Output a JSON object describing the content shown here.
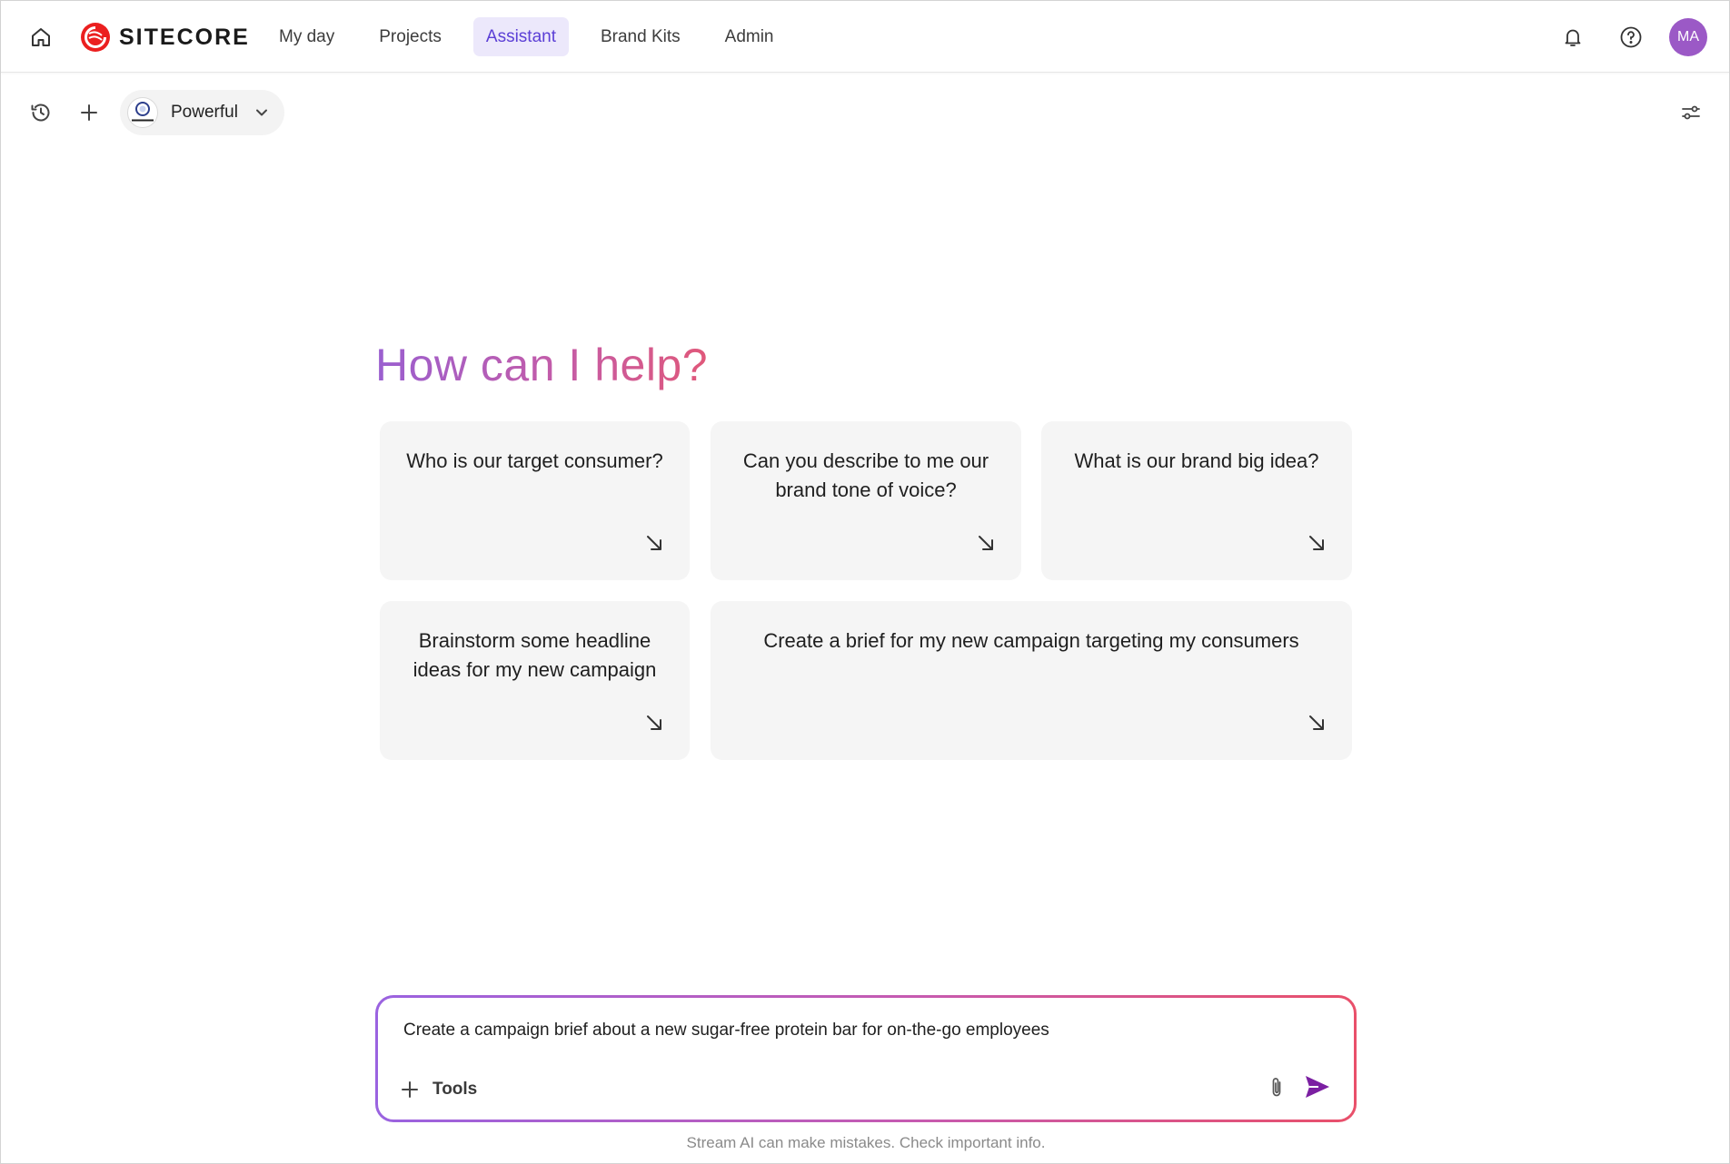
{
  "brand": {
    "name": "SITECORE",
    "color": "#eb1f1f"
  },
  "nav": {
    "items": [
      {
        "label": "My day"
      },
      {
        "label": "Projects"
      },
      {
        "label": "Assistant",
        "active": true
      },
      {
        "label": "Brand Kits"
      },
      {
        "label": "Admin"
      }
    ],
    "active_color": "#5b3fd6"
  },
  "user": {
    "initials": "MA",
    "avatar_color": "#9b59c6"
  },
  "toolbar": {
    "agent_name": "Powerful",
    "agent_logo_text": "Powerful"
  },
  "main": {
    "heading": "How can I help?",
    "suggestions": [
      {
        "text": "Who is our target consumer?"
      },
      {
        "text": "Can you describe to me our brand tone of voice?"
      },
      {
        "text": "What is our brand big idea?"
      },
      {
        "text": "Brainstorm some headline ideas for my new campaign"
      },
      {
        "text": "Create a brief for my new campaign targeting my consumers"
      }
    ]
  },
  "composer": {
    "value": "Create a campaign brief about a new sugar-free protein bar for on-the-go employees",
    "tools_label": "Tools",
    "send_color": "#7b1fa2"
  },
  "footer": {
    "disclaimer": "Stream AI can make mistakes. Check important info."
  },
  "icons": {
    "home": "home-icon",
    "bell": "bell-icon",
    "help": "help-icon",
    "history": "history-icon",
    "plus": "plus-icon",
    "chevron": "chevron-down-icon",
    "settings": "sliders-icon",
    "arrow": "arrow-down-right-icon",
    "attach": "paperclip-icon",
    "send": "send-icon"
  }
}
